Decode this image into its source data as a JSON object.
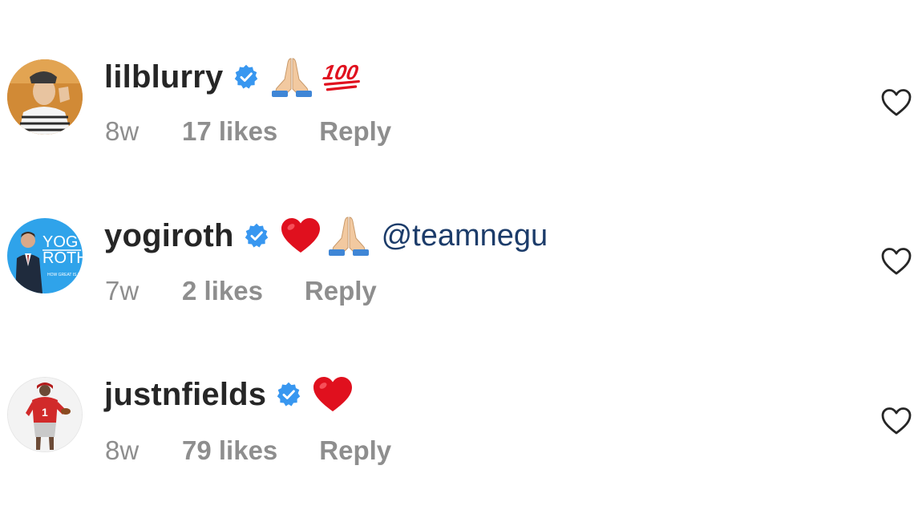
{
  "comments": [
    {
      "username": "lilblurry",
      "verified": true,
      "emojis": [
        "folded-hands-icon",
        "hundred-points-icon"
      ],
      "mention": "",
      "time": "8w",
      "likes": "17 likes",
      "reply": "Reply"
    },
    {
      "username": "yogiroth",
      "verified": true,
      "emojis": [
        "red-heart-icon",
        "folded-hands-icon"
      ],
      "mention": "@teamnegu",
      "time": "7w",
      "likes": "2 likes",
      "reply": "Reply"
    },
    {
      "username": "justnfields",
      "verified": true,
      "emojis": [
        "red-heart-icon"
      ],
      "mention": "",
      "time": "8w",
      "likes": "79 likes",
      "reply": "Reply"
    }
  ],
  "colors": {
    "username": "#262626",
    "meta": "#8e8e8e",
    "verified_badge": "#3897f0",
    "mention": "#1c3c6a",
    "heart_emoji": "#e0101e"
  }
}
